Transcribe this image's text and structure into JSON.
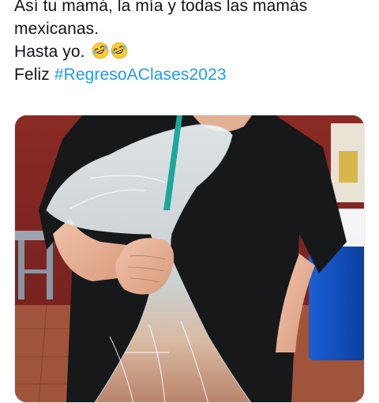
{
  "tweet": {
    "line1": "Así tu mamá, la mía y todas las mamás",
    "line2": "mexicanas.",
    "line3_text": "Hasta yo. ",
    "line3_emojis": [
      "rolling-on-floor-laughing-emoji",
      "rolling-on-floor-laughing-emoji"
    ],
    "line4_prefix": "Feliz ",
    "hashtag": "#RegresoAClases2023"
  },
  "media": {
    "kind": "photo",
    "subject": "person-in-black-tshirt-holding-plastic-bag-drink"
  },
  "colors": {
    "text": "#0f1419",
    "hashtag": "#1d9bf0",
    "background": "#ffffff",
    "media_border": "#e6e9eb"
  }
}
